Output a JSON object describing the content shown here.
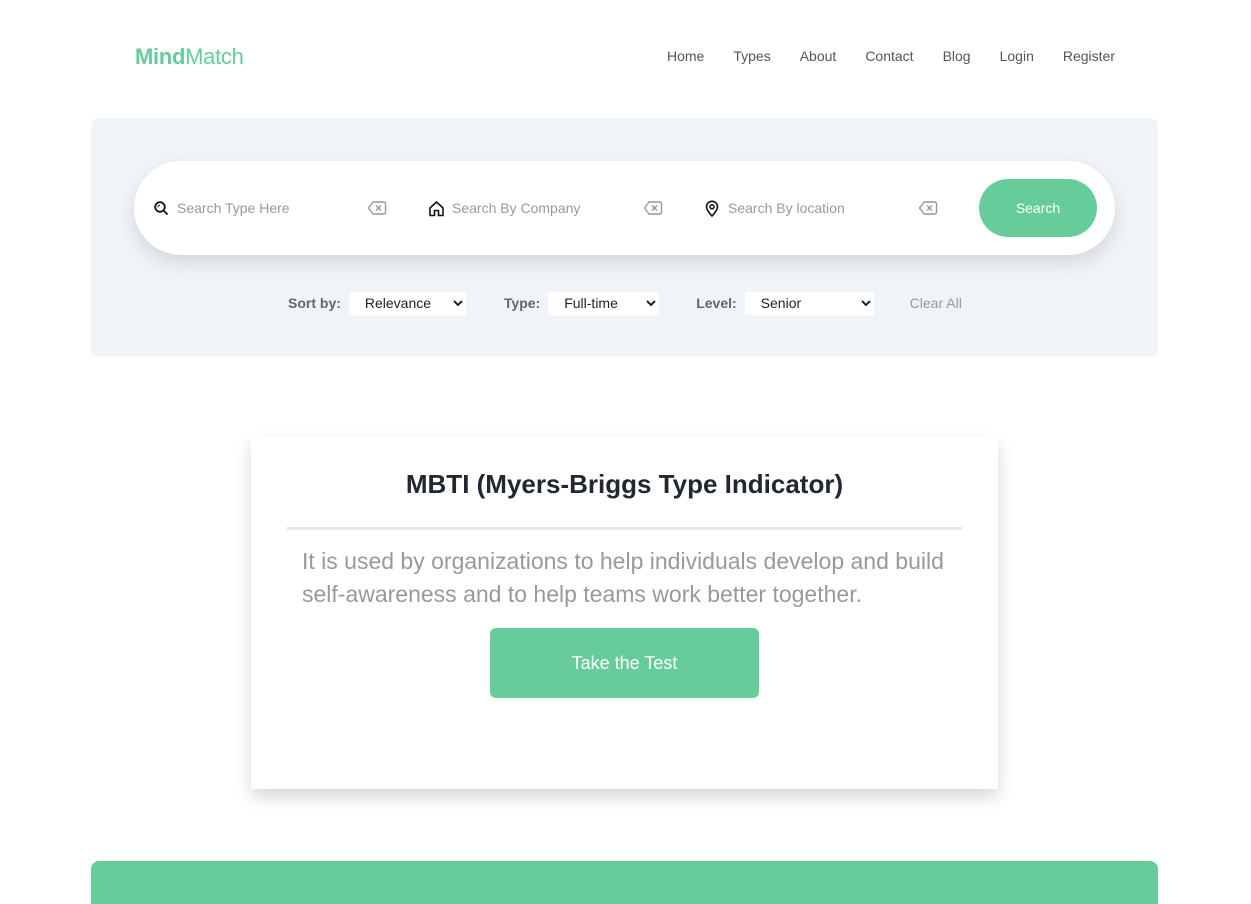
{
  "brand": {
    "name_bold": "Mind",
    "name_light": "Match",
    "color": "#66cc99"
  },
  "nav": {
    "items": [
      {
        "label": "Home"
      },
      {
        "label": "Types"
      },
      {
        "label": "About"
      },
      {
        "label": "Contact"
      },
      {
        "label": "Blog"
      },
      {
        "label": "Login"
      },
      {
        "label": "Register"
      }
    ]
  },
  "search": {
    "type_placeholder": "Search Type Here",
    "company_placeholder": "Search By Company",
    "location_placeholder": "Search By location",
    "button_label": "Search",
    "icons": {
      "type": "search-icon",
      "company": "home-icon",
      "location": "location-pin-icon",
      "clear": "backspace-clear-icon"
    }
  },
  "filters": {
    "sort_label": "Sort by:",
    "sort_value": "Relevance",
    "type_label": "Type:",
    "type_value": "Full-time",
    "level_label": "Level:",
    "level_value": "Senior",
    "clear_all_label": "Clear All"
  },
  "card": {
    "title": "MBTI (Myers-Briggs Type Indicator)",
    "description": "It is used by organizations to help individuals develop and build self-awareness and to help teams work better together.",
    "button_label": "Take the Test"
  },
  "colors": {
    "accent": "#66cc99",
    "panel_bg": "#f0f4f8"
  }
}
